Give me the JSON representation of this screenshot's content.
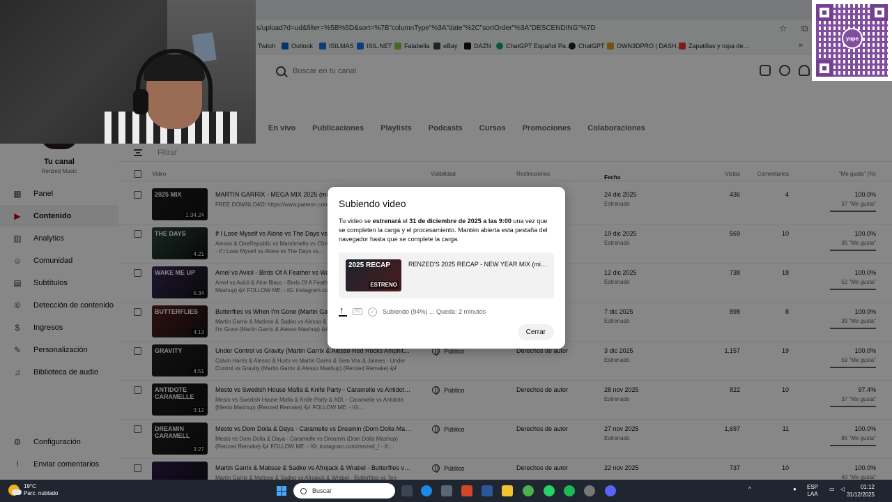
{
  "browser": {
    "url": "s/upload?d=ud&filter=%5B%5D&sort=%7B\"columnType\"%3A\"date\"%2C\"sortOrder\"%3A\"DESCENDING\"%7D",
    "bookmarks": [
      "Twitch",
      "Outlook",
      "ISILMAS",
      "ISIL.NET",
      "Falabella",
      "eBay",
      "DAZN",
      "ChatGPT Español Pa...",
      "ChatGPT",
      "OWN3DPRO | DASH...",
      "Zapatillas y ropa de..."
    ]
  },
  "qr": {
    "brand": "yape"
  },
  "search": {
    "placeholder": "Buscar en tu canal"
  },
  "channel": {
    "name": "Tu canal",
    "subtitle": "Renzed Music"
  },
  "sidebar": {
    "items": [
      {
        "label": "Panel",
        "icon": "dashboard-icon"
      },
      {
        "label": "Contenido",
        "icon": "content-icon"
      },
      {
        "label": "Analytics",
        "icon": "analytics-icon"
      },
      {
        "label": "Comunidad",
        "icon": "community-icon"
      },
      {
        "label": "Subtítulos",
        "icon": "subtitles-icon"
      },
      {
        "label": "Detección de contenido",
        "icon": "copyright-icon"
      },
      {
        "label": "Ingresos",
        "icon": "earn-icon"
      },
      {
        "label": "Personalización",
        "icon": "customization-icon"
      },
      {
        "label": "Biblioteca de audio",
        "icon": "audio-library-icon"
      }
    ],
    "bottom": [
      {
        "label": "Configuración",
        "icon": "settings-icon"
      },
      {
        "label": "Enviar comentarios",
        "icon": "feedback-icon"
      }
    ]
  },
  "tabs": [
    "En vivo",
    "Publicaciones",
    "Playlists",
    "Podcasts",
    "Cursos",
    "Promociones",
    "Colaboraciones"
  ],
  "filter": {
    "placeholder": "Filtrar"
  },
  "table": {
    "headers": {
      "video": "Video",
      "visibility": "Visibilidad",
      "restrictions": "Restricciones",
      "date": "Fecha",
      "views": "Vistas",
      "comments": "Comentarios",
      "likes": "\"Me gusta\" (%)"
    },
    "rows": [
      {
        "title": "MARTIN GARRIX - MEGA MIX 2025 (mixed by Renzed)",
        "desc": "FREE DOWNLOAD! https://www.patreon.com/posts/... 146565725?...",
        "thumb_text": "2025 MIX",
        "duration": "1:34:24",
        "visibility": "",
        "restrictions": "",
        "date": "24 dic 2025",
        "status": "Estrenado",
        "views": "436",
        "comments": "4",
        "likes": "100.0%",
        "likes_sub": "37 \"Me gusta\"",
        "thumb_color": "#1a1a1a"
      },
      {
        "title": "If I Lose Myself vs Alone vs The Days vs Feel So Close (Mashup)",
        "desc": "Alesso & OneRepublic vs Marshmello vs Chris Martin vs Calvin Harris... Kastra - If I Lose Myself vs Alone vs The Days vs...",
        "thumb_text": "THE DAYS",
        "duration": "4:21",
        "visibility": "",
        "restrictions": "",
        "date": "19 dic 2025",
        "status": "Estrenado",
        "views": "569",
        "comments": "10",
        "likes": "100.0%",
        "likes_sub": "35 \"Me gusta\"",
        "thumb_color": "#2c4a3c"
      },
      {
        "title": "Amel vs Avicii - Birds Of A Feather vs Wake Me Up (Mashup)",
        "desc": "Amel vs Avicii & Aloe Blacc - Birds Of A Feather vs Wake Me Up (Renzed Mashup) 🎶 FOLLOW ME: - IG: instagram.com/...",
        "thumb_text": "WAKE ME UP",
        "duration": "5:34",
        "visibility": "",
        "restrictions": "",
        "date": "12 dic 2025",
        "status": "Estrenado",
        "views": "738",
        "comments": "18",
        "likes": "100.0%",
        "likes_sub": "52 \"Me gusta\"",
        "thumb_color": "#3a2a5c"
      },
      {
        "title": "Butterflies vs When I'm Gone (Martin Garrix & Matisse & Sadko vs Alesso)",
        "desc": "Martin Garrix & Matisse & Sadko vs Alesso & Katy Perry - Butterflies vs When I'm Gone (Martin Garrix & Alesso Mashup) 🎶 FOLLOW...",
        "thumb_text": "BUTTERFLIES",
        "duration": "4:13",
        "visibility": "",
        "restrictions": "",
        "date": "7 dic 2025",
        "status": "Estrenado",
        "views": "898",
        "comments": "8",
        "likes": "100.0%",
        "likes_sub": "39 \"Me gusta\"",
        "thumb_color": "#5c2020"
      },
      {
        "title": "Under Control vs Gravity (Martin Garrix & Alesso Red Rocks Amphitheatre)",
        "desc": "Calvin Harris & Alesso & Hurts vs Martin Garrix & Sem Vox & Jaimes - Under Control vs Gravity (Martin Garrix & Alesso Mashup) (Renzed Remake) 🎶",
        "thumb_text": "GRAVITY",
        "duration": "4:51",
        "visibility": "Público",
        "restrictions": "Derechos de autor",
        "date": "3 dic 2025",
        "status": "Estrenado",
        "views": "1,157",
        "comments": "19",
        "likes": "100.0%",
        "likes_sub": "59 \"Me gusta\"",
        "thumb_color": "#222222"
      },
      {
        "title": "Mesto vs Swedish House Mafia & Knife Party - Caramelle vs Antidote (Mashup)",
        "desc": "Mesto vs Swedish House Mafia & Knife Party & ADL - Caramelle vs Antidote (Mesto Mashup) (Renzed Remake) 🎶 FOLLOW ME: - IG:...",
        "thumb_text": "ANTIDOTE CARAMELLE",
        "duration": "3:12",
        "visibility": "Público",
        "restrictions": "Derechos de autor",
        "date": "28 nov 2025",
        "status": "Estrenado",
        "views": "822",
        "comments": "10",
        "likes": "97.4%",
        "likes_sub": "37 \"Me gusta\"",
        "thumb_color": "#1c1c1c"
      },
      {
        "title": "Mesto vs Dom Dolla & Daya - Caramelle vs Dreamin (Dom Dolla Mashup)",
        "desc": "Mesto vs Dom Dolla & Daya - Caramelle vs Dreamin (Dom Dolla Mashup) (Renzed Remake) 🎶 FOLLOW ME: - IG: instagram.com/renzed_/ - X:...",
        "thumb_text": "DREAMIN CARAMELL",
        "duration": "3:27",
        "visibility": "Público",
        "restrictions": "Derechos de autor",
        "date": "27 nov 2025",
        "status": "Estrenado",
        "views": "1,697",
        "comments": "11",
        "likes": "100.0%",
        "likes_sub": "85 \"Me gusta\"",
        "thumb_color": "#202020"
      },
      {
        "title": "Martin Garrix & Matisse & Sadko vs Afrojack & Wrabel - Butterflies vs Te...",
        "desc": "Martin Garrix & Matisse & Sadko vs Afrojack & Wrabel - Butterflies vs Ten Feet...",
        "thumb_text": "",
        "duration": "",
        "visibility": "Público",
        "restrictions": "Derechos de autor",
        "date": "22 nov 2025",
        "status": "",
        "views": "737",
        "comments": "10",
        "likes": "100.0%",
        "likes_sub": "40 \"Me gusta\"",
        "thumb_color": "#2a1a4a"
      }
    ]
  },
  "modal": {
    "title": "Subiendo video",
    "msg_a": "Tu video se ",
    "msg_b": "estrenará",
    "msg_c": " el ",
    "msg_d": "31 de diciembre de 2025 a las 9:00",
    "msg_e": " una vez que se completen la carga y el procesamiento. Mantén abierta esta pestaña del navegador hasta que se complete la carga.",
    "thumb_title": "2025 RECAP",
    "thumb_badge": "ESTRENO",
    "video_title": "RENZED'S 2025 RECAP - NEW YEAR MIX (mixed ...",
    "sd_label": "SD",
    "status": "Subiendo (94%) ... Queda: 2 minutos",
    "progress_percent": 94,
    "close": "Cerrar"
  },
  "taskbar": {
    "temp": "19°C",
    "weather": "Parc. nublado",
    "search": "Buscar",
    "lang1": "ESP",
    "lang2": "LAA",
    "time": "01:12",
    "date": "31/12/2025"
  }
}
